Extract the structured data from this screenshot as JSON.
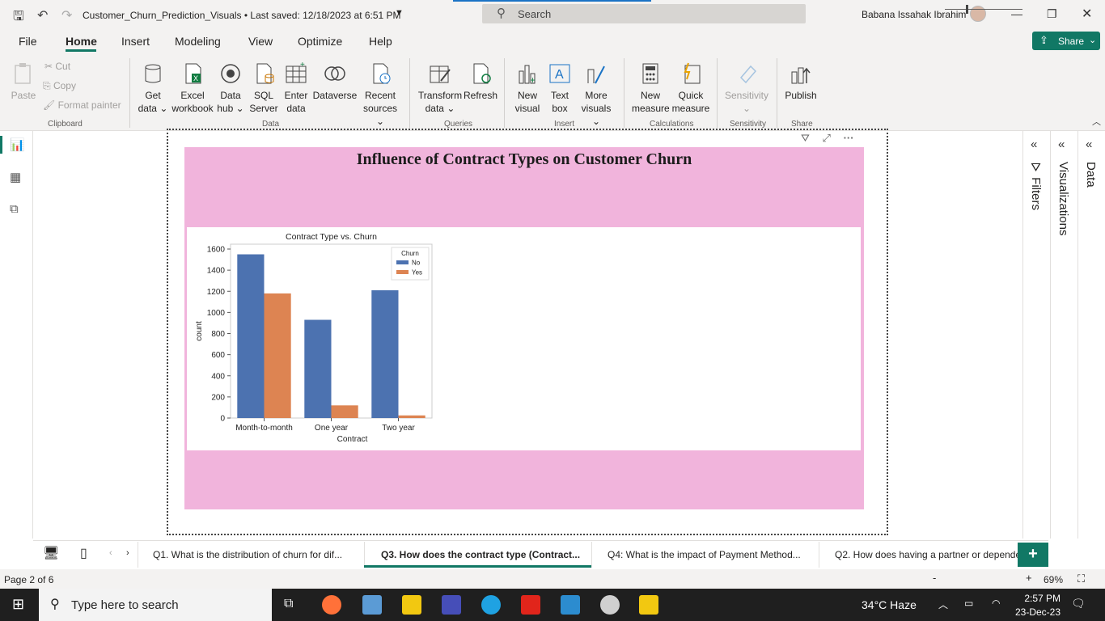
{
  "titlebar": {
    "document_title": "Customer_Churn_Prediction_Visuals • Last saved: 12/18/2023 at 6:51 PM",
    "search_placeholder": "Search",
    "user_name": "Babana Issahak Ibrahim"
  },
  "ribbon_tabs": [
    "File",
    "Home",
    "Insert",
    "Modeling",
    "View",
    "Optimize",
    "Help"
  ],
  "share_label": "Share",
  "clipboard": {
    "paste": "Paste",
    "cut": "Cut",
    "copy": "Copy",
    "format_painter": "Format painter",
    "group": "Clipboard"
  },
  "data_group": {
    "get_data": [
      "Get",
      "data ⌄"
    ],
    "excel": [
      "Excel",
      "workbook"
    ],
    "data_hub": [
      "Data",
      "hub ⌄"
    ],
    "sql": [
      "SQL",
      "Server"
    ],
    "enter_data": [
      "Enter",
      "data"
    ],
    "dataverse": [
      "Dataverse",
      ""
    ],
    "recent": [
      "Recent",
      "sources ⌄"
    ],
    "group": "Data"
  },
  "queries_group": {
    "transform": [
      "Transform",
      "data ⌄"
    ],
    "refresh": [
      "Refresh",
      ""
    ],
    "group": "Queries"
  },
  "insert_group": {
    "new_visual": [
      "New",
      "visual"
    ],
    "text_box": [
      "Text",
      "box"
    ],
    "more_visuals": [
      "More",
      "visuals ⌄"
    ],
    "group": "Insert"
  },
  "calc_group": {
    "new_measure": [
      "New",
      "measure"
    ],
    "quick_measure": [
      "Quick",
      "measure"
    ],
    "group": "Calculations"
  },
  "sensitivity_group": {
    "sensitivity": [
      "Sensitivity",
      "⌄"
    ],
    "group": "Sensitivity"
  },
  "share_group": {
    "publish": [
      "Publish",
      ""
    ],
    "group": "Share"
  },
  "visual": {
    "title": "Influence of Contract Types on Customer Churn"
  },
  "chart_data": {
    "type": "bar",
    "title": "Contract Type vs. Churn",
    "xlabel": "Contract",
    "ylabel": "count",
    "categories": [
      "Month-to-month",
      "One year",
      "Two year"
    ],
    "series": [
      {
        "name": "No",
        "values": [
          1550,
          930,
          1210
        ],
        "color": "#4c72b0"
      },
      {
        "name": "Yes",
        "values": [
          1180,
          120,
          25
        ],
        "color": "#dd8452"
      }
    ],
    "ylim": [
      0,
      1600
    ],
    "yticks": [
      0,
      200,
      400,
      600,
      800,
      1000,
      1200,
      1400,
      1600
    ],
    "legend_title": "Churn",
    "legend_position": "top-right",
    "grid": false
  },
  "right_panes": [
    "Filters",
    "Visualizations",
    "Data"
  ],
  "page_tabs": [
    "Q1. What is the distribution of churn for dif...",
    "Q3. How does the contract type (Contract...",
    "Q4: What is the impact of Payment Method...",
    "Q2. How does having a partner or depende"
  ],
  "status": {
    "page_indicator": "Page 2 of 6",
    "zoom": "69%"
  },
  "taskbar": {
    "search_placeholder": "Type here to search",
    "weather": "34°C  Haze",
    "time": "2:57 PM",
    "date": "23-Dec-23"
  }
}
